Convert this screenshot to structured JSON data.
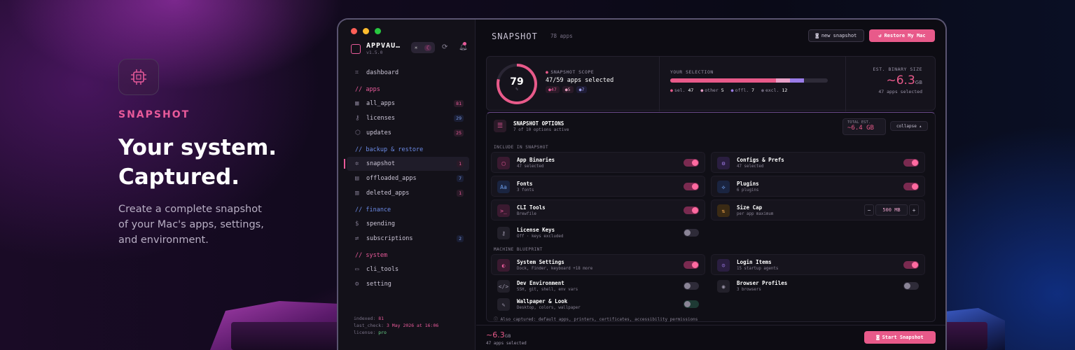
{
  "hero": {
    "tag": "SNAPSHOT",
    "title_line1": "Your system.",
    "title_line2": "Captured.",
    "desc_line1": "Create a complete snapshot",
    "desc_line2": "of your Mac's apps, settings,",
    "desc_line3": "and environment."
  },
  "sidebar": {
    "brand": "APPVAU…",
    "version": "v1.5.0",
    "items": [
      {
        "label": "dashboard",
        "icon": "grid-icon"
      },
      {
        "label": "all_apps",
        "badge": "81",
        "icon": "apps-icon"
      },
      {
        "label": "licenses",
        "badge": "29",
        "icon": "key-icon"
      },
      {
        "label": "updates",
        "badge": "25",
        "icon": "box-icon"
      },
      {
        "label": "snapshot",
        "badge": "1",
        "icon": "gear-icon"
      },
      {
        "label": "offloaded_apps",
        "badge": "7",
        "icon": "archive-icon"
      },
      {
        "label": "deleted_apps",
        "badge": "1",
        "icon": "trash-icon"
      },
      {
        "label": "spending",
        "icon": "dollar-icon"
      },
      {
        "label": "subscriptions",
        "badge": "2",
        "icon": "repeat-icon"
      },
      {
        "label": "cli_tools",
        "icon": "terminal-icon"
      },
      {
        "label": "setting",
        "icon": "settings-icon"
      }
    ],
    "sections": {
      "apps": "// apps",
      "backup": "// backup & restore",
      "finance": "// finance",
      "system": "// system"
    },
    "footer": {
      "indexed_label": "indexed:",
      "indexed": "81",
      "last_check_label": "last_check:",
      "last_check": "3 May 2026 at 16:06",
      "license_label": "license:",
      "license": "pro"
    }
  },
  "header": {
    "title": "SNAPSHOT",
    "count": "78 apps",
    "new_snapshot": "new snapshot",
    "restore": "Restore My Mac"
  },
  "stats": {
    "score": "79",
    "score_unit": "%",
    "scope_label": "SNAPSHOT SCOPE",
    "scope_value": "47/59 apps selected",
    "pills": [
      "47",
      "5",
      "7"
    ],
    "selection_label": "YOUR SELECTION",
    "selection": [
      {
        "label": "sel.",
        "value": "47",
        "color": "#e85a8a"
      },
      {
        "label": "other",
        "value": "5",
        "color": "#e8a0c8"
      },
      {
        "label": "offl.",
        "value": "7",
        "color": "#9a7ce8"
      },
      {
        "label": "excl.",
        "value": "12",
        "color": "#6a6478"
      }
    ],
    "est_label": "EST. BINARY SIZE",
    "est_value": "~6.3",
    "est_unit": "GB",
    "est_sub": "47 apps selected"
  },
  "options": {
    "title": "SNAPSHOT OPTIONS",
    "subtitle": "7 of 10 options active",
    "total_label": "TOTAL EST.",
    "total_value": "~6.4 GB",
    "collapse": "collapse ▴",
    "group1": "INCLUDE IN SNAPSHOT",
    "group2": "MACHINE BLUEPRINT",
    "items": [
      {
        "title": "App Binaries",
        "sub": "47 selected",
        "on": true
      },
      {
        "title": "Configs & Prefs",
        "sub": "47 selected",
        "on": true
      },
      {
        "title": "Fonts",
        "sub": "3 fonts",
        "on": true
      },
      {
        "title": "Plugins",
        "sub": "6 plugins",
        "on": true
      },
      {
        "title": "CLI Tools",
        "sub": "Brewfile",
        "on": true
      },
      {
        "title": "Size Cap",
        "sub": "per app maximum",
        "value": "500 MB"
      },
      {
        "title": "License Keys",
        "sub": "Off · keys excluded",
        "on": false
      },
      {
        "title": "System Settings",
        "sub": "Dock, Finder, keyboard +18 more",
        "on": true
      },
      {
        "title": "Login Items",
        "sub": "15 startup agents",
        "on": true
      },
      {
        "title": "Dev Environment",
        "sub": "SSH, git, shell, env vars",
        "on": false
      },
      {
        "title": "Browser Profiles",
        "sub": "3 browsers",
        "on": false
      },
      {
        "title": "Wallpaper & Look",
        "sub": "Desktop, colors, wallpaper",
        "on": false
      }
    ],
    "also": "Also captured: default apps, printers, certificates, accessibility permissions"
  },
  "footer": {
    "value": "~6.3",
    "unit": "GB",
    "sub": "47 apps selected",
    "start": "Start Snapshot"
  }
}
